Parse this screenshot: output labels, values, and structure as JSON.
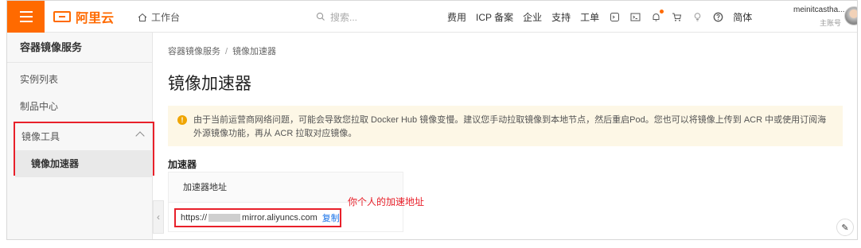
{
  "topbar": {
    "logo_text": "阿里云",
    "workbench": "工作台",
    "search_placeholder": "搜索...",
    "nav": [
      "费用",
      "ICP 备案",
      "企业",
      "支持",
      "工单"
    ],
    "lang": "简体",
    "user_name": "meinitcastha...",
    "user_role": "主账号",
    "accent": "#ff6a00"
  },
  "sidebar": {
    "title": "容器镜像服务",
    "items": [
      "实例列表",
      "制品中心"
    ],
    "group_label": "镜像工具",
    "active_item": "镜像加速器"
  },
  "main": {
    "breadcrumb": [
      "容器镜像服务",
      "镜像加速器"
    ],
    "title": "镜像加速器",
    "notice": "由于当前运营商网络问题，可能会导致您拉取 Docker Hub 镜像变慢。建议您手动拉取镜像到本地节点，然后重启Pod。您也可以将镜像上传到 ACR 中或使用订阅海外源镜像功能，再从 ACR 拉取对应镜像。",
    "section_title": "加速器",
    "card_header": "加速器地址",
    "address_prefix": "https://",
    "address_suffix": "mirror.aliyuncs.com",
    "copy_label": "复制",
    "hint": "你个人的加速地址"
  }
}
